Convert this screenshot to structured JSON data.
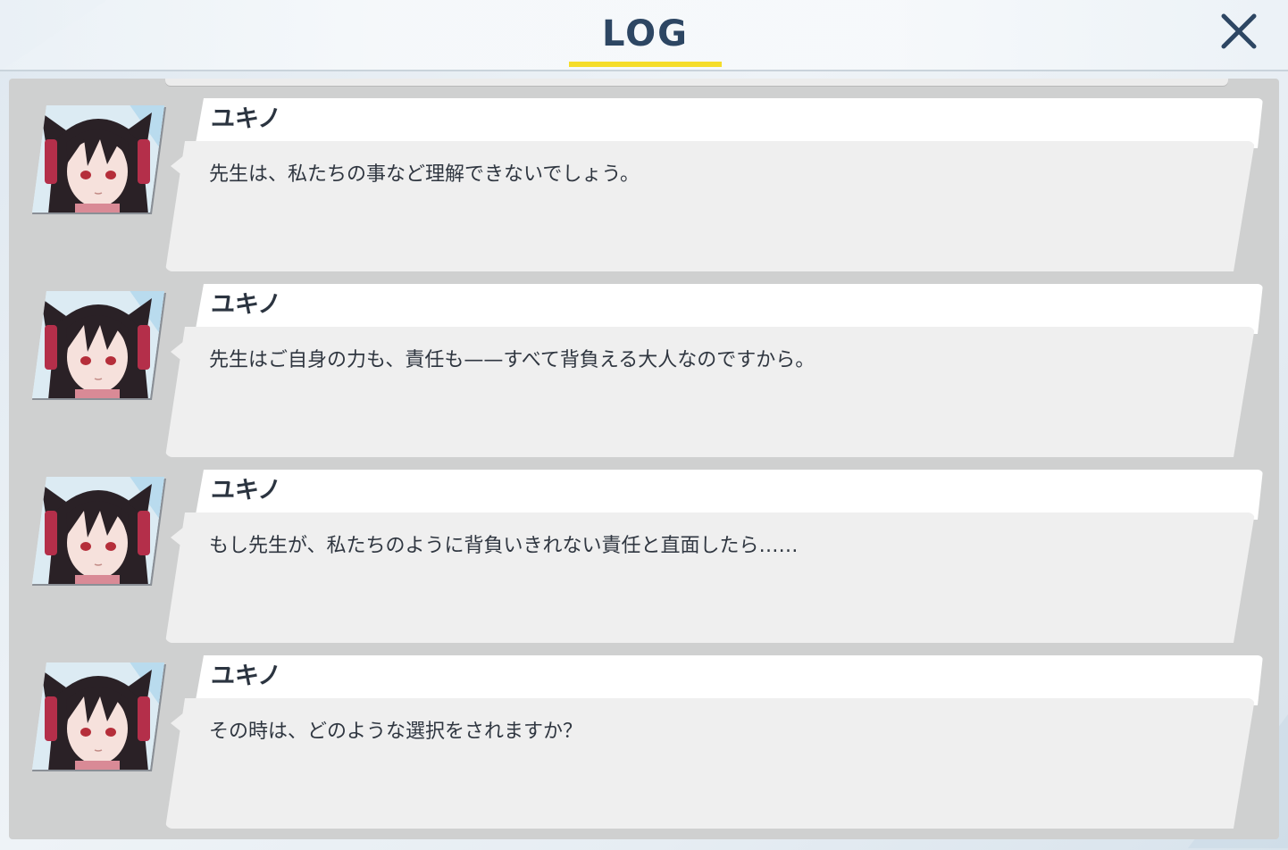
{
  "header": {
    "title": "LOG",
    "close_icon": "close-icon",
    "accent_color": "#f5dd2a",
    "title_color": "#2d4663"
  },
  "log": {
    "entries": [
      {
        "speaker": "ユキノ",
        "avatar_icon": "character-portrait-icon",
        "text": "先生は、私たちの事など理解できないでしょう。"
      },
      {
        "speaker": "ユキノ",
        "avatar_icon": "character-portrait-icon",
        "text": "先生はご自身の力も、責任も——すべて背負える大人なのですから。"
      },
      {
        "speaker": "ユキノ",
        "avatar_icon": "character-portrait-icon",
        "text": "もし先生が、私たちのように背負いきれない責任と直面したら……"
      },
      {
        "speaker": "ユキノ",
        "avatar_icon": "character-portrait-icon",
        "text": "その時は、どのような選択をされますか？"
      }
    ]
  }
}
